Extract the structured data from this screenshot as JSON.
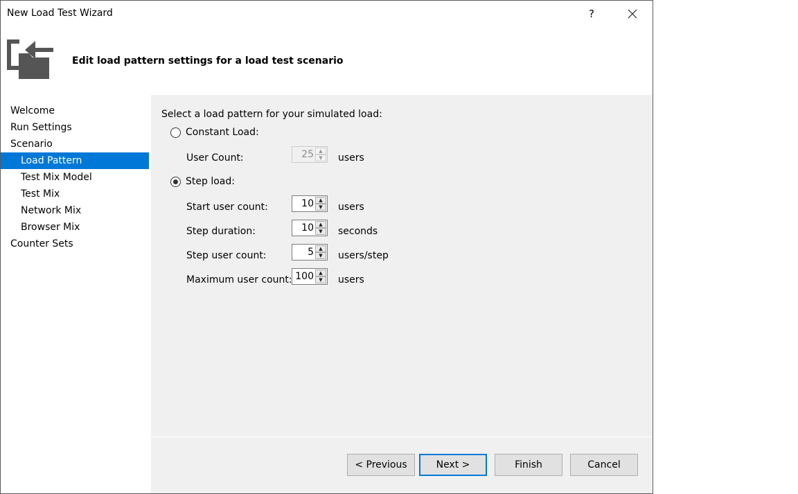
{
  "window": {
    "title": "New Load Test Wizard",
    "help_label": "?",
    "header_title": "Edit load pattern settings for a load test scenario"
  },
  "nav": {
    "items": [
      {
        "label": "Welcome",
        "level": 0,
        "selected": false
      },
      {
        "label": "Run Settings",
        "level": 0,
        "selected": false
      },
      {
        "label": "Scenario",
        "level": 0,
        "selected": false
      },
      {
        "label": "Load Pattern",
        "level": 1,
        "selected": true
      },
      {
        "label": "Test Mix Model",
        "level": 1,
        "selected": false
      },
      {
        "label": "Test Mix",
        "level": 1,
        "selected": false
      },
      {
        "label": "Network Mix",
        "level": 1,
        "selected": false
      },
      {
        "label": "Browser Mix",
        "level": 1,
        "selected": false
      },
      {
        "label": "Counter Sets",
        "level": 0,
        "selected": false
      }
    ]
  },
  "content": {
    "prompt": "Select a load pattern for your simulated load:",
    "constant": {
      "label": "Constant Load:",
      "selected": false,
      "user_count_label": "User Count:",
      "user_count_value": "25",
      "user_count_unit": "users"
    },
    "step": {
      "label": "Step load:",
      "selected": true,
      "fields": [
        {
          "label": "Start user count:",
          "value": "10",
          "unit": "users"
        },
        {
          "label": "Step duration:",
          "value": "10",
          "unit": "seconds"
        },
        {
          "label": "Step user count:",
          "value": "5",
          "unit": "users/step"
        },
        {
          "label": "Maximum user count:",
          "value": "100",
          "unit": "users"
        }
      ]
    }
  },
  "buttons": {
    "previous": "< Previous",
    "next": "Next >",
    "finish": "Finish",
    "cancel": "Cancel"
  },
  "colors": {
    "accent": "#0078d7",
    "pane_bg": "#f0f0f0",
    "icon_gray": "#555555"
  }
}
